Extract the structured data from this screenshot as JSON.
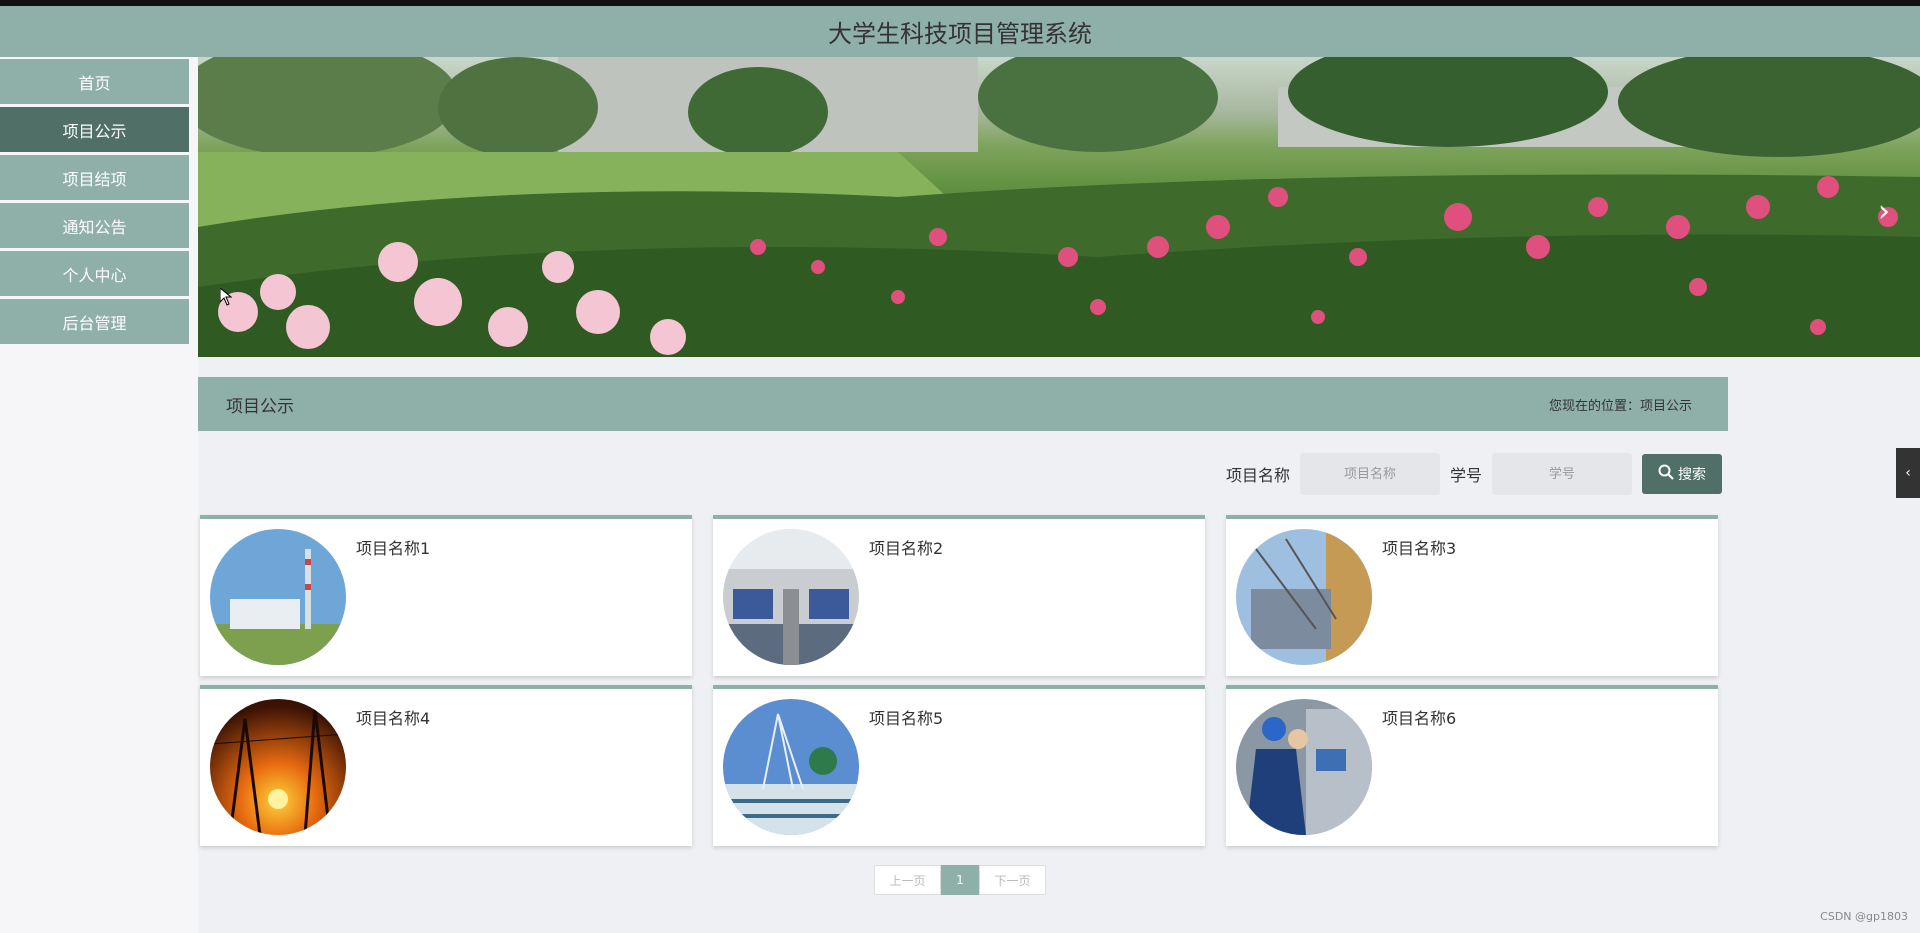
{
  "header": {
    "title": "大学生科技项目管理系统"
  },
  "sidebar": {
    "items": [
      {
        "label": "首页",
        "active": false
      },
      {
        "label": "项目公示",
        "active": true
      },
      {
        "label": "项目结项",
        "active": false
      },
      {
        "label": "通知公告",
        "active": false
      },
      {
        "label": "个人中心",
        "active": false
      },
      {
        "label": "后台管理",
        "active": false
      }
    ]
  },
  "banner": {
    "next_icon": "chevron-right-icon"
  },
  "section": {
    "title": "项目公示",
    "breadcrumb": "您现在的位置：项目公示"
  },
  "search": {
    "name_label": "项目名称",
    "name_placeholder": "项目名称",
    "name_value": "",
    "id_label": "学号",
    "id_placeholder": "学号",
    "id_value": "",
    "button_label": "搜索",
    "button_icon": "search-icon"
  },
  "projects": [
    {
      "name": "项目名称1",
      "image": "power-plant"
    },
    {
      "name": "项目名称2",
      "image": "control-room"
    },
    {
      "name": "项目名称3",
      "image": "substation"
    },
    {
      "name": "项目名称4",
      "image": "sunset-pylons"
    },
    {
      "name": "项目名称5",
      "image": "transmission-tower"
    },
    {
      "name": "项目名称6",
      "image": "workers-monitors"
    }
  ],
  "pager": {
    "prev": "上一页",
    "current": "1",
    "next": "下一页"
  },
  "side_tab_icon": "chevron-left-icon",
  "watermark": "CSDN @gp1803",
  "colors": {
    "accent": "#8fb0a9",
    "dark_accent": "#4f6f67"
  }
}
